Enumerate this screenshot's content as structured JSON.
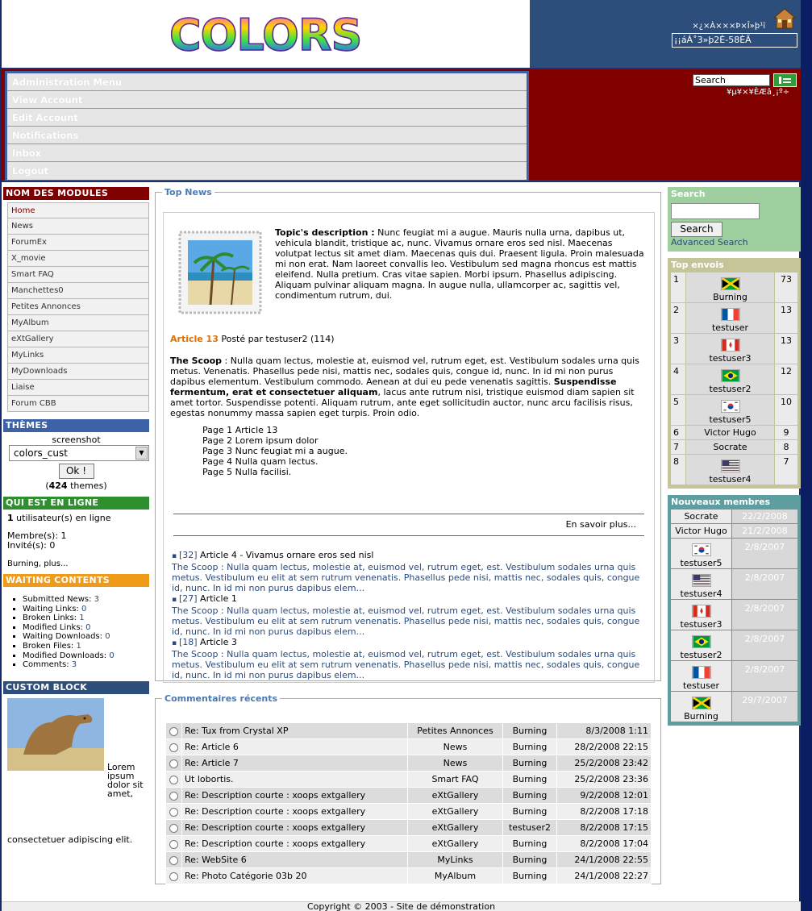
{
  "header": {
    "logo_text": "COLORS",
    "top_text": "×¿×À×××Þ×Î»þ¹ï",
    "box_text": "¡¡áÁ˚3»þ2È-58ÈÃ"
  },
  "menu": {
    "items": [
      "Administration Menu",
      "View Account",
      "Edit Account",
      "Notifications",
      "Inbox",
      "Logout"
    ]
  },
  "top_search": {
    "placeholder": "Search",
    "sub": "¥µ¥×¥ÈÆâ¸¡º÷"
  },
  "left": {
    "modules_title": "NOM DES MODULES",
    "modules": [
      "Home",
      "News",
      "ForumEx",
      "X_movie",
      "Smart FAQ",
      "Manchettes0",
      "Petites Annonces",
      "MyAlbum",
      "eXtGallery",
      "MyLinks",
      "MyDownloads",
      "Liaise",
      "Forum CBB"
    ],
    "themes_title": "THÈMES",
    "themes_label": "screenshot",
    "themes_value": "colors_cust",
    "themes_ok": "Ok !",
    "themes_count_pre": "(",
    "themes_count": "424",
    "themes_count_post": " themes)",
    "online_title": "QUI EST EN LIGNE",
    "online_count": "1",
    "online_text": " utilisateur(s) en ligne",
    "members": "Membre(s): 1",
    "guests": "Invité(s): 0",
    "online_users": "Burning, plus...",
    "waiting_title": "WAITING CONTENTS",
    "waiting": [
      {
        "label": "Submitted News: ",
        "value": "3"
      },
      {
        "label": "Waiting Links: ",
        "value": "0"
      },
      {
        "label": "Broken Links: ",
        "value": "1"
      },
      {
        "label": "Modified Links: ",
        "value": "0"
      },
      {
        "label": "Waiting Downloads: ",
        "value": "0"
      },
      {
        "label": "Broken Files: ",
        "value": "1"
      },
      {
        "label": "Modified Downloads: ",
        "value": "0"
      },
      {
        "label": "Comments: ",
        "value": "3"
      }
    ],
    "custom_title": "CUSTOM BLOCK",
    "custom_text": "Lorem ipsum dolor sit amet, consectetuer adipiscing elit."
  },
  "topnews": {
    "legend": "Top News",
    "desc_label": "Topic's description :",
    "desc_text": " Nunc feugiat mi a augue. Mauris nulla urna, dapibus ut, vehicula blandit, tristique ac, nunc. Vivamus ornare eros sed nisl. Maecenas volutpat lectus sit amet diam. Maecenas quis dui. Praesent ligula. Proin malesuada mi non erat. Nam laoreet convallis leo. Vestibulum sed magna rhoncus est mattis eleifend. Nulla pretium. Cras vitae sapien. Morbi ipsum. Phasellus adipiscing. Aliquam pulvinar aliquam magna. In augue nulla, ullamcorper ac, sagittis vel, condimentum rutrum, dui.",
    "article_title": "Article 13",
    "article_meta": " Posté par testuser2 (114)",
    "scoop_label": "The Scoop",
    "scoop_text": " : Nulla quam lectus, molestie at, euismod vel, rutrum eget, est. Vestibulum sodales urna quis metus. Venenatis. Phasellus pede nisi, mattis nec, sodales quis, congue id, nunc. In id mi non purus dapibus elementum. Vestibulum commodo. Aenean at dui eu pede venenatis sagittis. ",
    "scoop_bold": "Suspendisse fermentum, erat et consectetuer aliquam",
    "scoop_text2": ", lacus ante rutrum nisi, tristique euismod diam sapien sit amet tortor. Suspendisse potenti. Aliquam rutrum, ante eget sollicitudin auctor, nunc arcu facilisis risus, egestas nonummy massa sapien eget turpis. Proin odio.",
    "pages": [
      "Page 1 Article 13",
      "Page 2 Lorem ipsum dolor",
      "Page 3 Nunc feugiat mi a augue.",
      "Page 4 Nulla quam lectus.",
      "Page 5 Nulla facilisi."
    ],
    "more": "En savoir plus...",
    "list": [
      {
        "id": "[32]",
        "title": " Article 4 - Vivamus ornare eros sed nisl",
        "text": "The Scoop : Nulla quam lectus, molestie at, euismod vel, rutrum eget, est. Vestibulum sodales urna quis metus. Vestibulum eu elit at sem rutrum venenatis. Phasellus pede nisi, mattis nec, sodales quis, congue id, nunc. In id mi non purus dapibus elem..."
      },
      {
        "id": "[27]",
        "title": " Article 1",
        "text": "The Scoop : Nulla quam lectus, molestie at, euismod vel, rutrum eget, est. Vestibulum sodales urna quis metus. Vestibulum eu elit at sem rutrum venenatis. Phasellus pede nisi, mattis nec, sodales quis, congue id, nunc. In id mi non purus dapibus elem..."
      },
      {
        "id": "[18]",
        "title": " Article 3",
        "text": "The Scoop : Nulla quam lectus, molestie at, euismod vel, rutrum eget, est. Vestibulum sodales urna quis metus. Vestibulum eu elit at sem rutrum venenatis. Phasellus pede nisi, mattis nec, sodales quis, congue id, nunc. In id mi non purus dapibus elem..."
      }
    ]
  },
  "comments": {
    "legend": "Commentaires récents",
    "rows": [
      {
        "title": "Re: Tux from Crystal XP",
        "module": "Petites Annonces",
        "user": "Burning",
        "date": "8/3/2008 1:11"
      },
      {
        "title": "Re: Article 6",
        "module": "News",
        "user": "Burning",
        "date": "28/2/2008 22:15"
      },
      {
        "title": "Re: Article 7",
        "module": "News",
        "user": "Burning",
        "date": "25/2/2008 23:42"
      },
      {
        "title": "Ut lobortis.",
        "module": "Smart FAQ",
        "user": "Burning",
        "date": "25/2/2008 23:36"
      },
      {
        "title": "Re: Description courte : xoops extgallery",
        "module": "eXtGallery",
        "user": "Burning",
        "date": "9/2/2008 12:01"
      },
      {
        "title": "Re: Description courte : xoops extgallery",
        "module": "eXtGallery",
        "user": "Burning",
        "date": "8/2/2008 17:18"
      },
      {
        "title": "Re: Description courte : xoops extgallery",
        "module": "eXtGallery",
        "user": "testuser2",
        "date": "8/2/2008 17:15"
      },
      {
        "title": "Re: Description courte : xoops extgallery",
        "module": "eXtGallery",
        "user": "Burning",
        "date": "8/2/2008 17:04"
      },
      {
        "title": "Re: WebSite 6",
        "module": "MyLinks",
        "user": "Burning",
        "date": "24/1/2008 22:55"
      },
      {
        "title": "Re: Photo Catégorie 03b 20",
        "module": "MyAlbum",
        "user": "Burning",
        "date": "24/1/2008 22:27"
      }
    ]
  },
  "right": {
    "search_title": "Search",
    "search_btn": "Search",
    "search_adv": "Advanced Search",
    "top_title": "Top envois",
    "top": [
      {
        "rank": "1",
        "user": "Burning",
        "count": "73",
        "flag": "jm"
      },
      {
        "rank": "2",
        "user": "testuser",
        "count": "13",
        "flag": "fr"
      },
      {
        "rank": "3",
        "user": "testuser3",
        "count": "13",
        "flag": "ca"
      },
      {
        "rank": "4",
        "user": "testuser2",
        "count": "12",
        "flag": "br"
      },
      {
        "rank": "5",
        "user": "testuser5",
        "count": "10",
        "flag": "kr"
      },
      {
        "rank": "6",
        "user": "Victor Hugo",
        "count": "9",
        "flag": ""
      },
      {
        "rank": "7",
        "user": "Socrate",
        "count": "8",
        "flag": ""
      },
      {
        "rank": "8",
        "user": "testuser4",
        "count": "7",
        "flag": "us"
      }
    ],
    "new_title": "Nouveaux membres",
    "new": [
      {
        "user": "Socrate",
        "date": "22/2/2008",
        "flag": ""
      },
      {
        "user": "Victor Hugo",
        "date": "21/2/2008",
        "flag": ""
      },
      {
        "user": "testuser5",
        "date": "2/8/2007",
        "flag": "kr"
      },
      {
        "user": "testuser4",
        "date": "2/8/2007",
        "flag": "us"
      },
      {
        "user": "testuser3",
        "date": "2/8/2007",
        "flag": "ca"
      },
      {
        "user": "testuser2",
        "date": "2/8/2007",
        "flag": "br"
      },
      {
        "user": "testuser",
        "date": "2/8/2007",
        "flag": "fr"
      },
      {
        "user": "Burning",
        "date": "29/7/2007",
        "flag": "jm"
      }
    ]
  },
  "footer": {
    "text": "Copyright © 2003 - Site de démonstration"
  },
  "colors": {
    "header_blue": "#2d4e7a",
    "menu_red": "#800000",
    "accent_orange": "#e07000",
    "green_block": "#9fcf9f",
    "olive_block": "#c6c59a",
    "teal_block": "#5e9ea0"
  }
}
